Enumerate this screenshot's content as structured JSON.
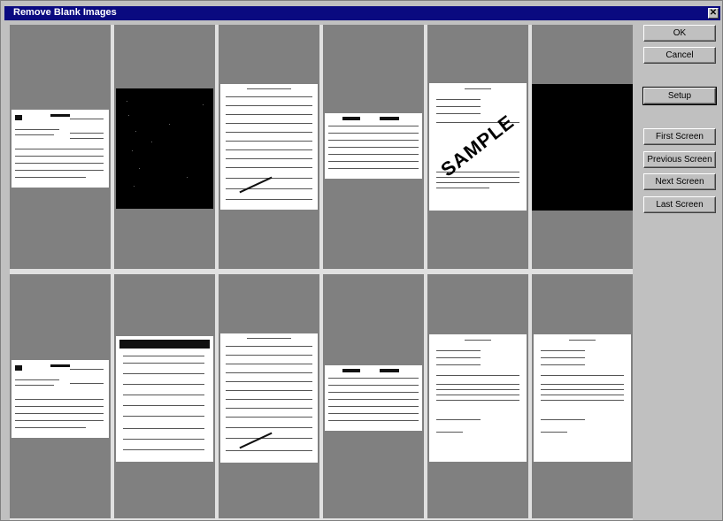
{
  "window": {
    "title": "Remove Blank Images",
    "close_glyph": "✕"
  },
  "buttons": {
    "ok": "OK",
    "cancel": "Cancel",
    "setup": "Setup",
    "first_screen": "First Screen",
    "previous_screen": "Previous Screen",
    "next_screen": "Next Screen",
    "last_screen": "Last Screen"
  },
  "thumbnails": [
    {
      "kind": "invoice",
      "blank": false
    },
    {
      "kind": "black-speckled",
      "blank": true
    },
    {
      "kind": "form",
      "blank": false
    },
    {
      "kind": "table",
      "blank": false
    },
    {
      "kind": "sample-letter",
      "blank": false,
      "watermark": "SAMPLE"
    },
    {
      "kind": "black",
      "blank": true
    },
    {
      "kind": "invoice",
      "blank": false
    },
    {
      "kind": "questionnaire",
      "blank": false
    },
    {
      "kind": "form",
      "blank": false
    },
    {
      "kind": "table",
      "blank": false
    },
    {
      "kind": "letter",
      "blank": false
    },
    {
      "kind": "letter",
      "blank": false
    }
  ],
  "colors": {
    "titlebar": "#0a0a80",
    "cell": "#808080",
    "dialog": "#c0c0c0"
  },
  "icons": {
    "close": "close-icon"
  }
}
